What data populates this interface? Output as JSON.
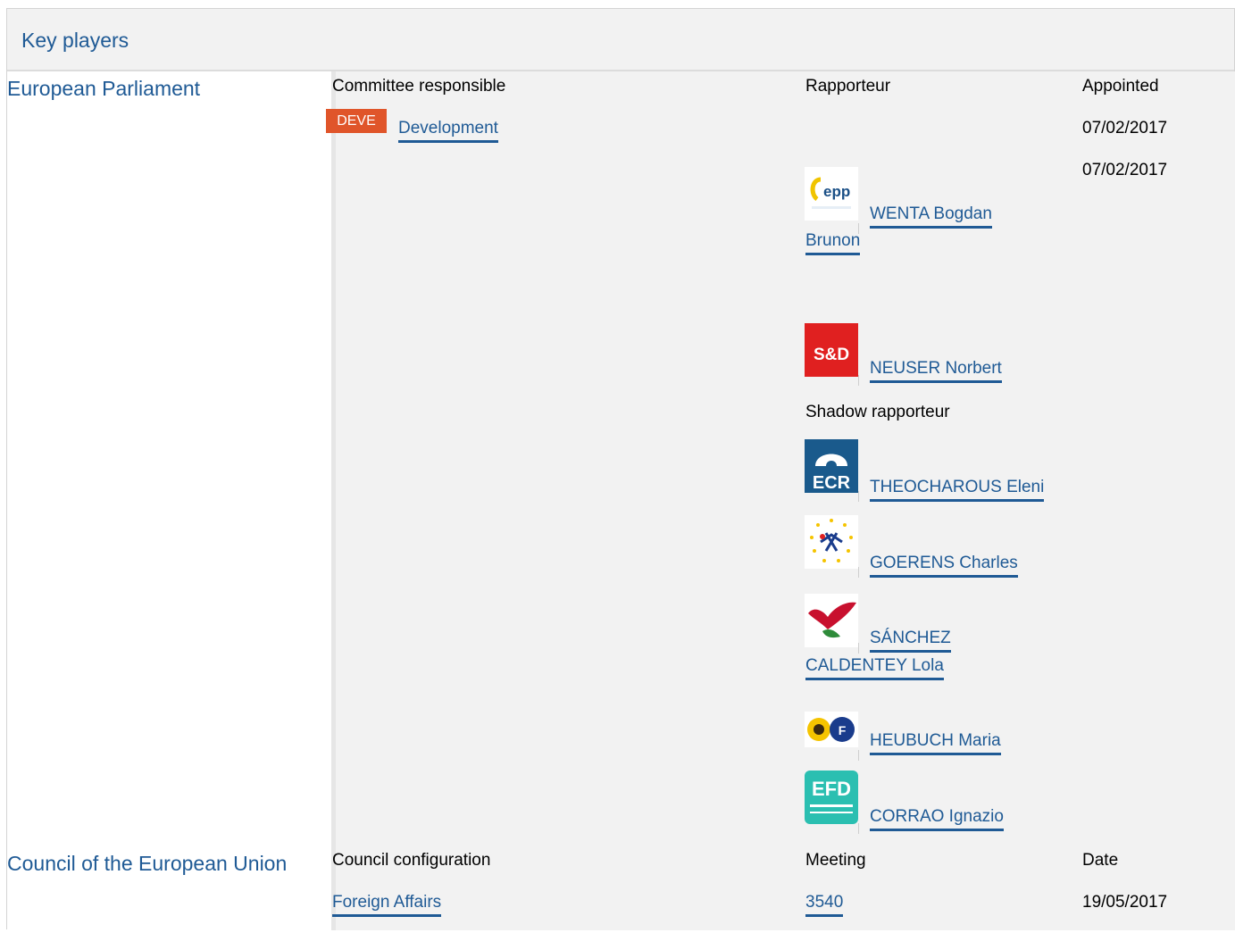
{
  "header": {
    "title": "Key players"
  },
  "ep": {
    "institution": "European Parliament",
    "committee_label": "Committee responsible",
    "rapporteur_label": "Rapporteur",
    "appointed_label": "Appointed",
    "committee_code": "DEVE",
    "committee_name": "Development",
    "appointed_dates": [
      "07/02/2017",
      "07/02/2017"
    ],
    "rapporteurs": [
      {
        "name_line1": "WENTA Bogdan",
        "name_line2": "Brunon",
        "group_icon": "epp-logo-icon"
      },
      {
        "name_line1": "NEUSER Norbert",
        "name_line2": "",
        "group_icon": "sd-logo-icon"
      }
    ],
    "shadow_label": "Shadow rapporteur",
    "shadows": [
      {
        "name_line1": "THEOCHAROUS Eleni",
        "name_line2": "",
        "group_icon": "ecr-logo-icon"
      },
      {
        "name_line1": "GOERENS Charles",
        "name_line2": "",
        "group_icon": "alde-logo-icon"
      },
      {
        "name_line1": "SÁNCHEZ",
        "name_line2": "CALDENTEY Lola",
        "group_icon": "gue-logo-icon"
      },
      {
        "name_line1": "HEUBUCH Maria",
        "name_line2": "",
        "group_icon": "greens-logo-icon"
      },
      {
        "name_line1": "CORRAO Ignazio",
        "name_line2": "",
        "group_icon": "efd-logo-icon"
      }
    ],
    "colors": {
      "badge": "#e0552a",
      "link": "#1f5a95"
    }
  },
  "council": {
    "institution": "Council of the European Union",
    "config_label": "Council configuration",
    "meeting_label": "Meeting",
    "date_label": "Date",
    "config_value": "Foreign Affairs",
    "meeting_value": "3540",
    "date_value": "19/05/2017"
  }
}
